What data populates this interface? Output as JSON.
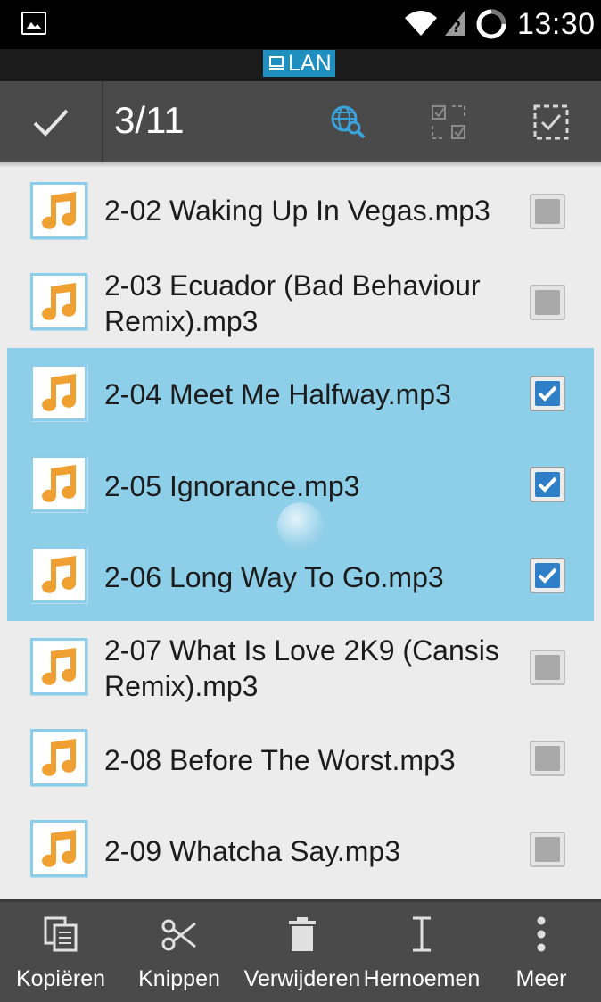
{
  "status_bar": {
    "time": "13:30"
  },
  "connection": {
    "label": "LAN"
  },
  "action_bar": {
    "selection_count": "3/11"
  },
  "files": [
    {
      "name": "2-02 Waking Up In Vegas.mp3",
      "selected": false
    },
    {
      "name": "2-03 Ecuador (Bad Behaviour Remix).mp3",
      "selected": false
    },
    {
      "name": "2-04 Meet Me Halfway.mp3",
      "selected": true
    },
    {
      "name": "2-05 Ignorance.mp3",
      "selected": true
    },
    {
      "name": "2-06 Long Way To Go.mp3",
      "selected": true
    },
    {
      "name": "2-07 What Is Love 2K9 (Cansis Remix).mp3",
      "selected": false
    },
    {
      "name": "2-08 Before The Worst.mp3",
      "selected": false
    },
    {
      "name": "2-09 Whatcha Say.mp3",
      "selected": false
    }
  ],
  "bottom_bar": {
    "copy_label": "Kopiëren",
    "cut_label": "Knippen",
    "delete_label": "Verwijderen",
    "rename_label": "Hernoemen",
    "more_label": "Meer"
  },
  "colors": {
    "selected_row": "#8dcfe9",
    "lan_badge": "#1e8fbf",
    "checkbox_checked": "#2f7fc8",
    "music_note": "#f0a030",
    "action_bar": "#4a4a4a"
  },
  "icons": [
    "image-icon",
    "wifi-icon",
    "signal-icon",
    "sync-ring-icon",
    "computer-icon",
    "check-icon",
    "globe-search-icon",
    "select-inverse-icon",
    "select-all-icon",
    "music-file-icon",
    "copy-icon",
    "scissors-icon",
    "trash-icon",
    "rename-icon",
    "more-icon"
  ]
}
